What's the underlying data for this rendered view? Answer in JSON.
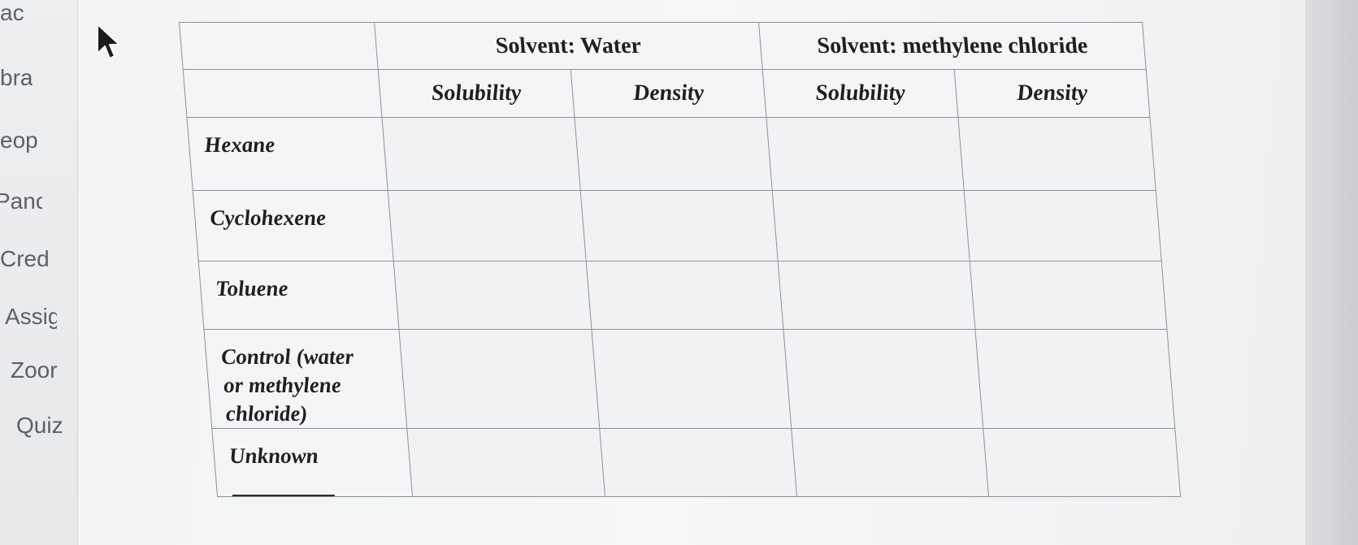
{
  "sidebar": {
    "items": [
      {
        "label": "ac"
      },
      {
        "label": "bra"
      },
      {
        "label": "eop"
      },
      {
        "label": "Panc"
      },
      {
        "label": "Cred"
      },
      {
        "label": "Assig"
      },
      {
        "label": "Zoor"
      },
      {
        "label": "Quiz"
      }
    ]
  },
  "table": {
    "header": {
      "corner": "",
      "water": "Solvent:  Water",
      "methylene": "Solvent: methylene chloride"
    },
    "subheader": {
      "blank": "",
      "water_solubility": "Solubility",
      "water_density": "Density",
      "mc_solubility": "Solubility",
      "mc_density": "Density"
    },
    "rows": [
      {
        "label": "Hexane",
        "water_solubility": "",
        "water_density": "",
        "mc_solubility": "",
        "mc_density": ""
      },
      {
        "label": "Cyclohexene",
        "water_solubility": "",
        "water_density": "",
        "mc_solubility": "",
        "mc_density": ""
      },
      {
        "label": "Toluene",
        "water_solubility": "",
        "water_density": "",
        "mc_solubility": "",
        "mc_density": ""
      },
      {
        "label_lines": [
          "Control (water",
          "or methylene",
          "chloride)"
        ],
        "water_solubility": "",
        "water_density": "",
        "mc_solubility": "",
        "mc_density": ""
      },
      {
        "label": "Unknown",
        "water_solubility": "",
        "water_density": "",
        "mc_solubility": "",
        "mc_density": ""
      }
    ]
  },
  "icons": {
    "cursor": "mouse-pointer-icon"
  }
}
